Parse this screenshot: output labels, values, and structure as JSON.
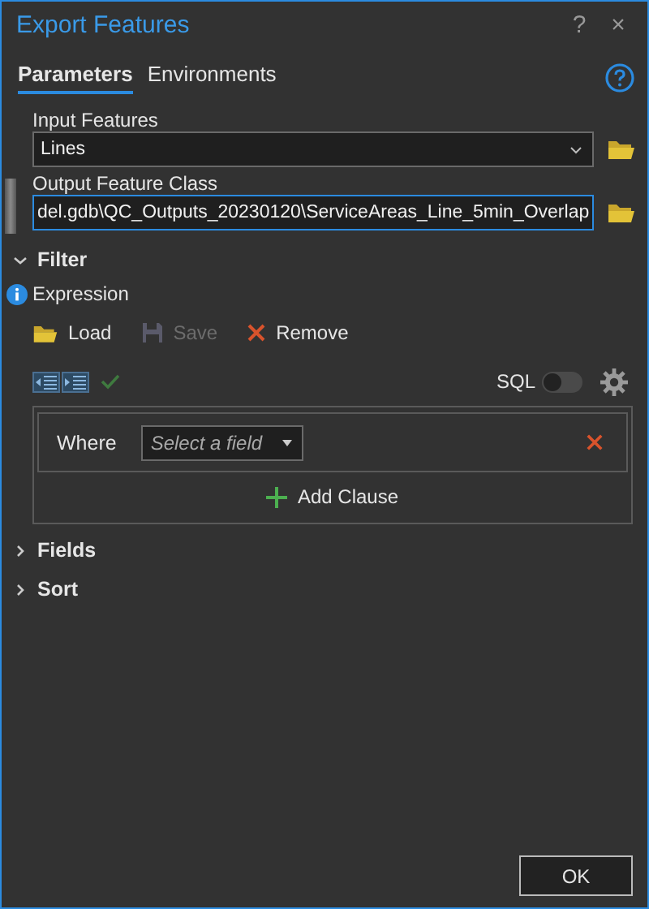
{
  "window": {
    "title": "Export Features",
    "help": "?",
    "close": "×"
  },
  "tabs": [
    {
      "label": "Parameters",
      "selected": true
    },
    {
      "label": "Environments",
      "selected": false
    }
  ],
  "parameters": [
    {
      "label": "Input Features",
      "value": "Lines",
      "kind": "dropdown",
      "focused": false
    },
    {
      "label": "Output Feature Class",
      "value": "del.gdb\\QC_Outputs_20230120\\ServiceAreas_Line_5min_Overlap",
      "kind": "text",
      "focused": true
    }
  ],
  "filter": {
    "label": "Filter",
    "expanded": true,
    "expression_label": "Expression",
    "actions": [
      {
        "label": "Load",
        "kind": "load",
        "disabled": false
      },
      {
        "label": "Save",
        "kind": "save",
        "disabled": true
      },
      {
        "label": "Remove",
        "kind": "remove",
        "disabled": false
      }
    ],
    "sql": {
      "label": "SQL",
      "on": false
    },
    "clause": {
      "where": "Where",
      "field_placeholder": "Select a field"
    },
    "add_clause": "Add Clause"
  },
  "sections": [
    {
      "label": "Fields",
      "expanded": false
    },
    {
      "label": "Sort",
      "expanded": false
    }
  ],
  "buttons": [
    "OK"
  ]
}
